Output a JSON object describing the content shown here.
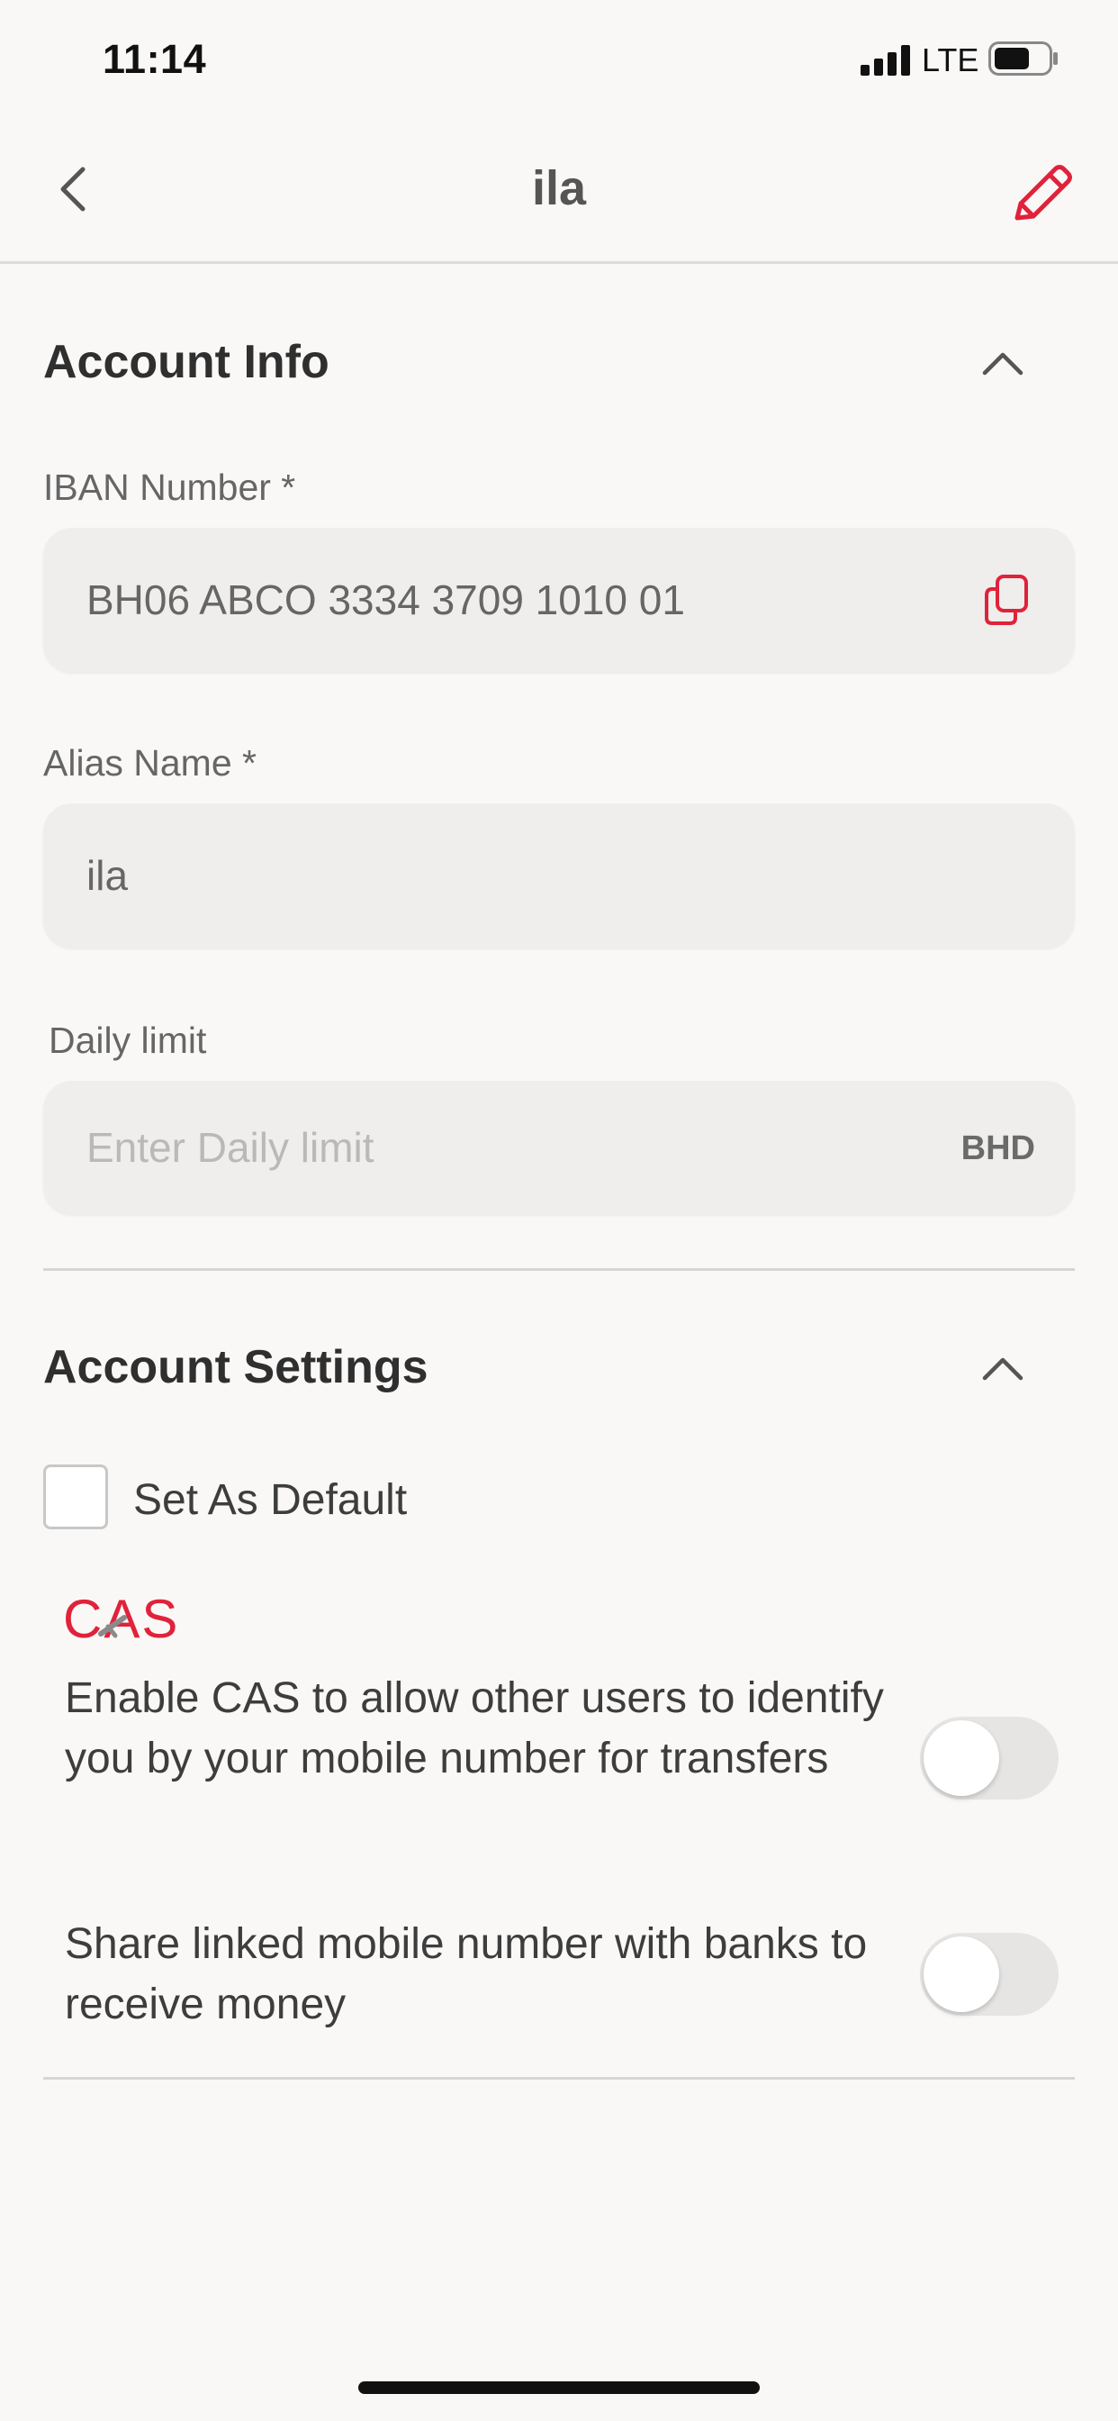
{
  "status_bar": {
    "time": "11:14",
    "network": "LTE"
  },
  "nav": {
    "title": "ila",
    "back_icon": "chevron-left-icon",
    "edit_icon": "pencil-icon"
  },
  "account_info": {
    "title": "Account Info",
    "iban_label": "IBAN Number *",
    "iban_value": "BH06 ABCO 3334 3709 1010 01",
    "alias_label": "Alias Name *",
    "alias_value": "ila",
    "daily_limit_label": "Daily limit",
    "daily_limit_placeholder": "Enter Daily limit",
    "currency": "BHD"
  },
  "account_settings": {
    "title": "Account Settings",
    "default_label": "Set As Default",
    "default_checked": false,
    "cas_logo": "CAS",
    "cas_text": "Enable CAS to allow other users to identify you by your mobile number for transfers",
    "cas_enabled": false,
    "share_text": "Share linked mobile number with banks to receive money",
    "share_enabled": false
  },
  "colors": {
    "accent": "#e0223a",
    "background": "#f9f8f7",
    "field": "#efeeed"
  }
}
